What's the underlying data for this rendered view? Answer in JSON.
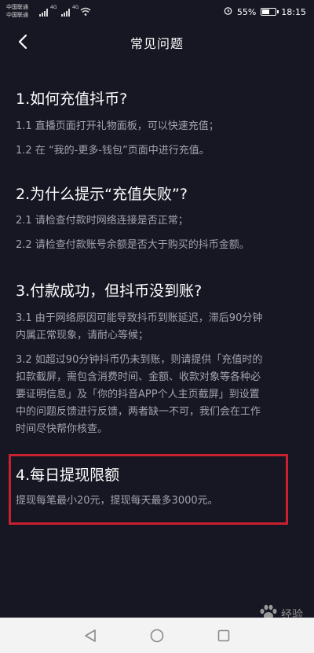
{
  "status": {
    "carrier1": "中国联通",
    "carrier2": "中国联通",
    "network1": "4G",
    "network2": "4G",
    "battery": "55%",
    "battery_level": 0.55,
    "time": "18:15"
  },
  "nav": {
    "title": "常见问题"
  },
  "faq": [
    {
      "heading": "1.如何充值抖币?",
      "lines": [
        "1.1 直播页面打开礼物面板，可以快速充值；",
        "1.2 在 “我的-更多-钱包”页面中进行充值。"
      ]
    },
    {
      "heading": "2.为什么提示“充值失败”?",
      "lines": [
        "2.1 请检查付款时网络连接是否正常；",
        "2.2 请检查付款账号余额是否大于购买的抖币金额。"
      ]
    },
    {
      "heading": "3.付款成功，但抖币没到账?",
      "lines": [
        "3.1 由于网络原因可能导致抖币到账延迟，滞后90分钟",
        "内属正常现象，请耐心等候；",
        "3.2 如超过90分钟抖币仍未到账，则请提供「充值时的",
        "扣款截屏，需包含消费时间、金额、收款对象等各种必",
        "要证明信息」及「你的抖音APP个人主页截屏」到设置",
        "中的问题反馈进行反馈，两者缺一不可，我们会在工作",
        "时间尽快帮你核查。"
      ]
    },
    {
      "heading": "4.每日提现限额",
      "lines": [
        "提现每笔最小20元，提现每天最多3000元。"
      ]
    }
  ],
  "watermark": {
    "text": "经验"
  },
  "colors": {
    "background": "#161723",
    "highlight_border": "#c8202f",
    "secondary_text": "#a3a4ad"
  }
}
